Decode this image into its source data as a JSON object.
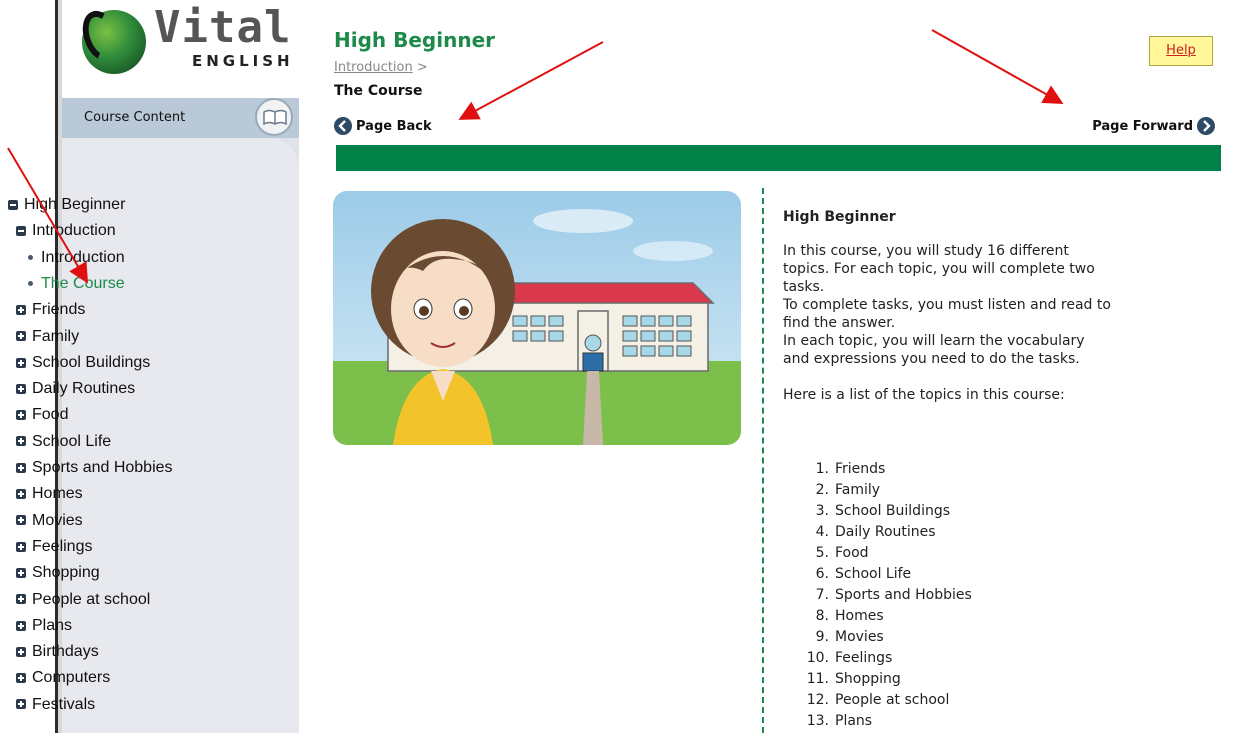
{
  "logo": {
    "word": "Vital",
    "sub": "ENGLISH"
  },
  "sidebar": {
    "header": "Course Content",
    "tree": [
      {
        "label": "High Beginner",
        "kind": "minus",
        "indent": 0
      },
      {
        "label": "Introduction",
        "kind": "minus",
        "indent": 1
      },
      {
        "label": "Introduction",
        "kind": "dot",
        "indent": 2
      },
      {
        "label": "The Course",
        "kind": "dot",
        "indent": 2,
        "active": true
      },
      {
        "label": "Friends",
        "kind": "plus",
        "indent": 1
      },
      {
        "label": "Family",
        "kind": "plus",
        "indent": 1
      },
      {
        "label": "School Buildings",
        "kind": "plus",
        "indent": 1
      },
      {
        "label": "Daily Routines",
        "kind": "plus",
        "indent": 1
      },
      {
        "label": "Food",
        "kind": "plus",
        "indent": 1
      },
      {
        "label": "School Life",
        "kind": "plus",
        "indent": 1
      },
      {
        "label": "Sports and Hobbies",
        "kind": "plus",
        "indent": 1
      },
      {
        "label": "Homes",
        "kind": "plus",
        "indent": 1
      },
      {
        "label": "Movies",
        "kind": "plus",
        "indent": 1
      },
      {
        "label": "Feelings",
        "kind": "plus",
        "indent": 1
      },
      {
        "label": "Shopping",
        "kind": "plus",
        "indent": 1
      },
      {
        "label": "People at school",
        "kind": "plus",
        "indent": 1
      },
      {
        "label": "Plans",
        "kind": "plus",
        "indent": 1
      },
      {
        "label": "Birthdays",
        "kind": "plus",
        "indent": 1
      },
      {
        "label": "Computers",
        "kind": "plus",
        "indent": 1
      },
      {
        "label": "Festivals",
        "kind": "plus",
        "indent": 1
      }
    ]
  },
  "header": {
    "title": "High Beginner",
    "breadcrumb_link": "Introduction",
    "breadcrumb_sep": " >",
    "subtitle": "The Course",
    "help": "Help",
    "back": "Page Back",
    "forward": "Page Forward"
  },
  "colors": {
    "brand_green": "#008148",
    "title_green": "#1d8a4a",
    "help_bg": "#fff79a",
    "arrow_red": "#e01010"
  },
  "article": {
    "heading": "High Beginner",
    "lines1": [
      "In this course, you will study 16 different",
      "topics. For each topic, you will complete two",
      "tasks.",
      "To complete tasks, you must listen and read to",
      "find the answer.",
      "In each topic, you will learn the vocabulary",
      "and expressions you need to do the tasks."
    ],
    "list_intro": "Here is a list of the topics in this course:",
    "topics": [
      "Friends",
      "Family",
      "School Buildings",
      "Daily Routines",
      "Food",
      "School Life",
      "Sports and Hobbies",
      "Homes",
      "Movies",
      "Feelings",
      "Shopping",
      "People at school",
      "Plans"
    ]
  }
}
